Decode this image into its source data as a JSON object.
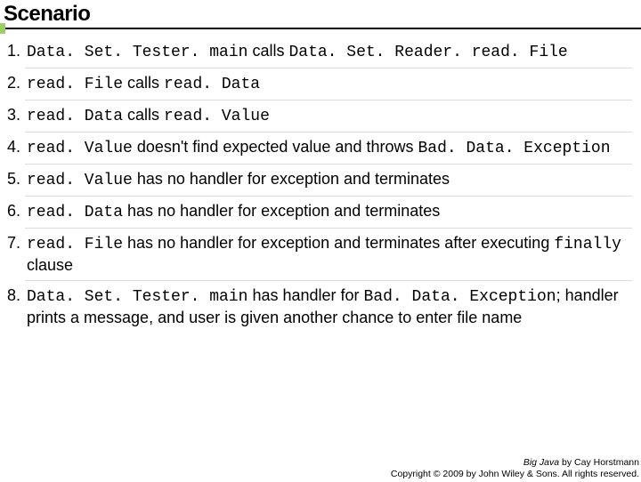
{
  "title": "Scenario",
  "steps": [
    {
      "parts": [
        {
          "t": "Data. Set. Tester. main",
          "c": true
        },
        {
          "t": " calls ",
          "c": false
        },
        {
          "t": "Data. Set. Reader. read. File",
          "c": true
        }
      ]
    },
    {
      "parts": [
        {
          "t": "read. File",
          "c": true
        },
        {
          "t": " calls ",
          "c": false
        },
        {
          "t": "read. Data",
          "c": true
        }
      ]
    },
    {
      "parts": [
        {
          "t": "read. Data",
          "c": true
        },
        {
          "t": " calls ",
          "c": false
        },
        {
          "t": "read. Value",
          "c": true
        }
      ]
    },
    {
      "parts": [
        {
          "t": "read. Value",
          "c": true
        },
        {
          "t": " doesn't find expected value and throws ",
          "c": false
        },
        {
          "t": "Bad. Data. Exception",
          "c": true
        }
      ]
    },
    {
      "parts": [
        {
          "t": "read. Value",
          "c": true
        },
        {
          "t": " has no handler for exception and terminates",
          "c": false
        }
      ]
    },
    {
      "parts": [
        {
          "t": "read. Data",
          "c": true
        },
        {
          "t": " has no handler for exception and terminates",
          "c": false
        }
      ]
    },
    {
      "parts": [
        {
          "t": "read. File",
          "c": true
        },
        {
          "t": " has no handler for exception and terminates after executing ",
          "c": false
        },
        {
          "t": "finally",
          "c": true
        },
        {
          "t": " clause",
          "c": false
        }
      ]
    },
    {
      "parts": [
        {
          "t": "Data. Set. Tester. main",
          "c": true
        },
        {
          "t": " has handler for ",
          "c": false
        },
        {
          "t": "Bad. Data. Exception",
          "c": true
        },
        {
          "t": "; handler prints a message, and user is given another chance to enter file name",
          "c": false
        }
      ]
    }
  ],
  "footer": {
    "book": "Big Java",
    "byline": " by Cay Horstmann",
    "copyright": "Copyright © 2009 by John Wiley & Sons. All rights reserved."
  }
}
